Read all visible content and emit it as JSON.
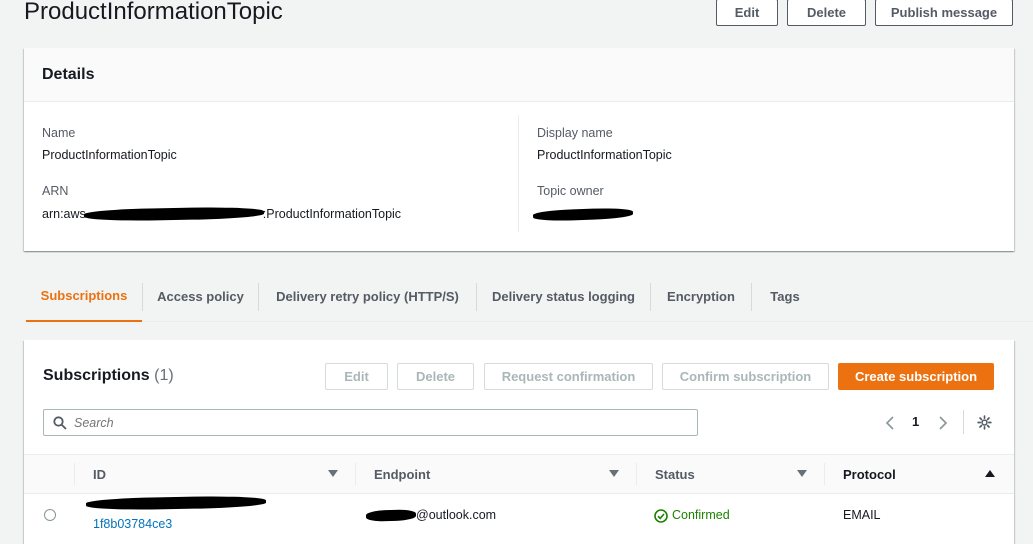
{
  "page": {
    "title": "ProductInformationTopic"
  },
  "header_actions": {
    "edit": "Edit",
    "delete": "Delete",
    "publish": "Publish message"
  },
  "details": {
    "heading": "Details",
    "name_label": "Name",
    "name_value": "ProductInformationTopic",
    "arn_label": "ARN",
    "arn_prefix": "arn:aws",
    "arn_suffix": ":ProductInformationTopic",
    "display_name_label": "Display name",
    "display_name_value": "ProductInformationTopic",
    "topic_owner_label": "Topic owner"
  },
  "tabs": [
    {
      "label": "Subscriptions",
      "active": true
    },
    {
      "label": "Access policy"
    },
    {
      "label": "Delivery retry policy (HTTP/S)"
    },
    {
      "label": "Delivery status logging"
    },
    {
      "label": "Encryption"
    },
    {
      "label": "Tags"
    }
  ],
  "subscriptions": {
    "title": "Subscriptions",
    "count": "(1)",
    "actions": {
      "edit": "Edit",
      "delete": "Delete",
      "request_confirmation": "Request confirmation",
      "confirm_subscription": "Confirm subscription",
      "create_subscription": "Create subscription"
    },
    "search_placeholder": "Search",
    "page_number": "1",
    "columns": {
      "id": "ID",
      "endpoint": "Endpoint",
      "status": "Status",
      "protocol": "Protocol"
    },
    "rows": [
      {
        "id_visible": "1f8b03784ce3",
        "endpoint_visible": "@outlook.com",
        "status": "Confirmed",
        "protocol": "EMAIL"
      }
    ]
  },
  "colors": {
    "accent": "#ec7211",
    "link": "#0073bb",
    "success": "#1d8102",
    "text": "#16191f",
    "muted": "#545b64"
  }
}
